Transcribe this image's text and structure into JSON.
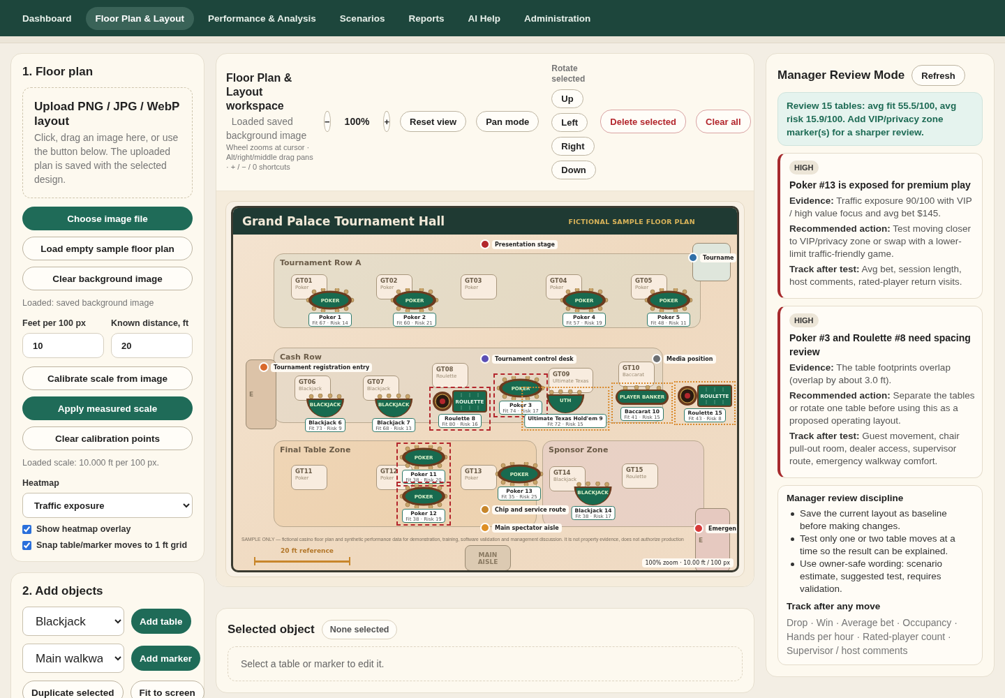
{
  "nav": [
    {
      "label": "Dashboard",
      "selected": false
    },
    {
      "label": "Floor Plan & Layout",
      "selected": true
    },
    {
      "label": "Performance & Analysis",
      "selected": false
    },
    {
      "label": "Scenarios",
      "selected": false
    },
    {
      "label": "Reports",
      "selected": false
    },
    {
      "label": "AI Help",
      "selected": false
    },
    {
      "label": "Administration",
      "selected": false
    }
  ],
  "floor_plan_panel": {
    "title": "1. Floor plan",
    "upload": {
      "title": "Upload PNG / JPG / WebP layout",
      "text": "Click, drag an image here, or use the button below. The uploaded plan is saved with the selected design."
    },
    "buttons": [
      {
        "label": "Choose image file",
        "kind": "primary"
      },
      {
        "label": "Load empty sample floor plan",
        "kind": "outline"
      },
      {
        "label": "Clear background image",
        "kind": "outline"
      }
    ],
    "status": "Loaded: saved background image",
    "fields": [
      {
        "label": "Feet per 100 px",
        "value": "10"
      },
      {
        "label": "Known distance, ft",
        "value": "20"
      }
    ],
    "scale_buttons": [
      {
        "label": "Calibrate scale from image",
        "kind": "outline"
      },
      {
        "label": "Apply measured scale",
        "kind": "primary"
      },
      {
        "label": "Clear calibration points",
        "kind": "outline"
      }
    ],
    "scale_status": "Loaded scale: 10.000 ft per 100 px.",
    "heatmap": {
      "label": "Heatmap",
      "value": "Traffic exposure"
    },
    "checkboxes": [
      {
        "label": "Show heatmap overlay",
        "checked": true
      },
      {
        "label": "Snap table/marker moves to 1 ft grid",
        "checked": true
      }
    ]
  },
  "add_objects": {
    "title": "2. Add objects",
    "rows": [
      {
        "select": "Blackjack",
        "button": "Add table"
      },
      {
        "select": "Main walkwa",
        "button": "Add marker"
      }
    ],
    "buttons": [
      "Duplicate selected",
      "Fit to screen"
    ]
  },
  "workspace": {
    "title": "Floor Plan & Layout workspace",
    "status": "Loaded saved background image",
    "hint": "Wheel zooms at cursor · Alt/right/middle drag pans · + / − / 0 shortcuts",
    "zoom_out": "−",
    "zoom": "100%",
    "zoom_in": "+",
    "view_buttons": [
      "Reset view",
      "Pan mode"
    ],
    "rotate_label": "Rotate selected",
    "rotate_buttons": [
      "Up",
      "Left",
      "Right",
      "Down"
    ],
    "danger_buttons": [
      "Delete selected",
      "Clear all"
    ]
  },
  "floor_plan": {
    "title": "Grand Palace Tournament Hall",
    "tag": "FICTIONAL SAMPLE FLOOR PLAN",
    "zones": [
      {
        "label": "Tournament Row A"
      },
      {
        "label": "Cash Row"
      },
      {
        "label": "Final Table Zone"
      },
      {
        "label": "Sponsor Zone"
      }
    ],
    "rooms": [
      {
        "label": "E"
      },
      {
        "label": "E"
      },
      {
        "label": "MAIN AISLE"
      }
    ],
    "slots": [
      {
        "code": "GT01",
        "type": "Poker"
      },
      {
        "code": "GT02",
        "type": "Poker"
      },
      {
        "code": "GT03",
        "type": "Poker"
      },
      {
        "code": "GT04",
        "type": "Poker"
      },
      {
        "code": "GT05",
        "type": "Poker"
      },
      {
        "code": "GT06",
        "type": "Blackjack"
      },
      {
        "code": "GT07",
        "type": "Blackjack"
      },
      {
        "code": "GT08",
        "type": "Roulette"
      },
      {
        "code": "GT09",
        "type": "Ultimate Texas"
      },
      {
        "code": "GT10",
        "type": "Baccarat"
      },
      {
        "code": "GT11",
        "type": "Poker"
      },
      {
        "code": "GT12",
        "type": "Poker"
      },
      {
        "code": "GT13",
        "type": "Poker"
      },
      {
        "code": "GT14",
        "type": "Blackjack"
      },
      {
        "code": "GT15",
        "type": "Roulette"
      }
    ],
    "tables": [
      {
        "kind": "poker",
        "felt": "POKER",
        "name": "Poker 1",
        "reading": "Fit 67 · Risk 14",
        "overlap": false,
        "clearance_warning": false
      },
      {
        "kind": "poker",
        "felt": "POKER",
        "name": "Poker 2",
        "reading": "Fit 60 · Risk 21",
        "overlap": false,
        "clearance_warning": false
      },
      {
        "kind": "poker",
        "felt": "POKER",
        "name": "Poker 4",
        "reading": "Fit 57 · Risk 19",
        "overlap": false,
        "clearance_warning": false
      },
      {
        "kind": "poker",
        "felt": "POKER",
        "name": "Poker 5",
        "reading": "Fit 48 · Risk 11",
        "overlap": false,
        "clearance_warning": false
      },
      {
        "kind": "blackjack",
        "felt": "BLACKJACK",
        "name": "Blackjack 6",
        "reading": "Fit 73 · Risk 9",
        "overlap": false,
        "clearance_warning": false
      },
      {
        "kind": "blackjack",
        "felt": "BLACKJACK",
        "name": "Blackjack 7",
        "reading": "Fit 68 · Risk 13",
        "overlap": false,
        "clearance_warning": false
      },
      {
        "kind": "roulette",
        "felt": "ROULETTE",
        "name": "Roulette 8",
        "reading": "Fit 80 · Risk 16",
        "overlap": true,
        "clearance_warning": false
      },
      {
        "kind": "poker",
        "felt": "POKER",
        "name": "Poker 3",
        "reading": "Fit 74 · Risk 17",
        "overlap": true,
        "clearance_warning": false
      },
      {
        "kind": "uth",
        "felt": "UTH",
        "name": "Ultimate Texas Hold'em 9",
        "reading": "Fit 72 · Risk 15",
        "overlap": false,
        "clearance_warning": true
      },
      {
        "kind": "baccarat",
        "felt": "PLAYER BANKER",
        "name": "Baccarat 10",
        "reading": "Fit 41 · Risk 15",
        "overlap": false,
        "clearance_warning": true
      },
      {
        "kind": "roulette",
        "felt": "ROULETTE",
        "name": "Roulette 15",
        "reading": "Fit 43 · Risk 8",
        "overlap": false,
        "clearance_warning": true
      },
      {
        "kind": "poker",
        "felt": "POKER",
        "name": "Poker 11",
        "reading": "Fit 38 · Risk 20",
        "overlap": true,
        "clearance_warning": false
      },
      {
        "kind": "poker",
        "felt": "POKER",
        "name": "Poker 12",
        "reading": "Fit 38 · Risk 19",
        "overlap": true,
        "clearance_warning": false
      },
      {
        "kind": "poker",
        "felt": "POKER",
        "name": "Poker 13",
        "reading": "Fit 35 · Risk 25",
        "overlap": false,
        "clearance_warning": false
      },
      {
        "kind": "blackjack",
        "felt": "BLACKJACK",
        "name": "Blackjack 14",
        "reading": "Fit 38 · Risk 17",
        "overlap": false,
        "clearance_warning": false
      }
    ],
    "markers": [
      {
        "label": "Presentation stage",
        "color": "#b3272d"
      },
      {
        "label": "Tourname",
        "color": "#2f6fa8"
      },
      {
        "label": "Tournament control desk",
        "color": "#5b4fb5"
      },
      {
        "label": "Media position",
        "color": "#6b6f73"
      },
      {
        "label": "Tournament registration entry",
        "color": "#d9692b"
      },
      {
        "label": "Chip and service route",
        "color": "#c7862b"
      },
      {
        "label": "Main spectator aisle",
        "color": "#de8f24"
      },
      {
        "label": "Emergen",
        "color": "#d63a3a"
      }
    ],
    "footnote": "SAMPLE ONLY — fictional casino floor plan and synthetic performance data for demonstration, training, software validation and management discussion. It is not property evidence, does not authorize production",
    "scale_label": "20 ft reference",
    "zoom_badge": "100% zoom · 10.00 ft / 100 px"
  },
  "selected_object": {
    "title": "Selected object",
    "badge": "None selected",
    "empty": "Select a table or marker to edit it."
  },
  "review": {
    "title": "Manager Review Mode",
    "refresh": "Refresh",
    "summary": "Review 15 tables: avg fit 55.5/100, avg risk 15.9/100. Add VIP/privacy zone marker(s) for a sharper review.",
    "findings": [
      {
        "severity": "HIGH",
        "title": "Poker #13 is exposed for premium play",
        "lines": [
          "**Evidence:** Traffic exposure 90/100 with VIP / high value focus and avg bet $145.",
          "**Recommended action:** Test moving closer to VIP/privacy zone or swap with a lower-limit traffic-friendly game.",
          "**Track after test:** Avg bet, session length, host comments, rated-player return visits."
        ]
      },
      {
        "severity": "HIGH",
        "title": "Poker #3 and Roulette #8 need spacing review",
        "lines": [
          "**Evidence:** The table footprints overlap (overlap by about 3.0 ft).",
          "**Recommended action:** Separate the tables or rotate one table before using this as a proposed operating layout.",
          "**Track after test:** Guest movement, chair pull-out room, dealer access, supervisor route, emergency walkway comfort."
        ]
      }
    ],
    "discipline": {
      "title": "Manager review discipline",
      "bullets": [
        "Save the current layout as baseline before making changes.",
        "Test only one or two table moves at a time so the result can be explained.",
        "Use owner-safe wording: scenario estimate, suggested test, requires validation."
      ],
      "track_title": "Track after any move",
      "track_text": "Drop · Win · Average bet · Occupancy · Hands per hour · Rated-player count · Supervisor / host comments"
    }
  }
}
